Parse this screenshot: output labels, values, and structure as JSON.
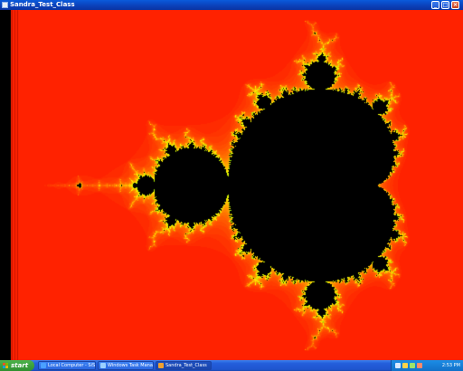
{
  "window": {
    "title": "Sandra_Test_Class",
    "controls": {
      "minimize": "_",
      "maximize": "□",
      "close": "×"
    }
  },
  "fractal": {
    "type": "mandelbrot",
    "center_re": -0.7,
    "center_im": 0.0,
    "re_min": -2.3,
    "re_max": 0.85,
    "max_iterations": 60,
    "colors": {
      "background": "#ff2200",
      "set": "#000000",
      "edge_orange": "#ff9900",
      "edge_yellow": "#ffff00",
      "edge_green": "#7cd400"
    }
  },
  "taskbar": {
    "start_label": "start",
    "tasks": [
      {
        "label": "Local Computer - SiSo...",
        "icon": "computer-icon",
        "active": false
      },
      {
        "label": "Windows Task Manager",
        "icon": "task-manager-icon",
        "active": false
      },
      {
        "label": "Sandra_Test_Class",
        "icon": "java-app-icon",
        "active": true
      }
    ],
    "clock": "2:53 PM",
    "colors": {
      "taskbar": "#245edb",
      "start": "#3a9a3a",
      "tray": "#1b8de6"
    }
  }
}
